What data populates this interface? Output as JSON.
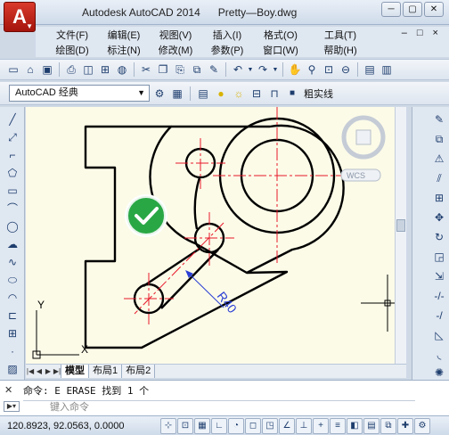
{
  "app": {
    "product": "Autodesk AutoCAD 2014",
    "filename": "Pretty—Boy.dwg",
    "logo_letter": "A"
  },
  "window_controls": {
    "minimize": "─",
    "restore": "▢",
    "close": "✕"
  },
  "menu": {
    "row1": [
      "文件(F)",
      "编辑(E)",
      "视图(V)",
      "插入(I)",
      "格式(O)",
      "工具(T)"
    ],
    "row2": [
      "绘图(D)",
      "标注(N)",
      "修改(M)",
      "参数(P)",
      "窗口(W)",
      "帮助(H)"
    ],
    "doc_controls": "– □ ×"
  },
  "workspace": {
    "current": "AutoCAD 经典",
    "layer": "粗实线"
  },
  "viewcube": {
    "label": "WCS"
  },
  "layout_tabs": [
    "模型",
    "布局1",
    "布局2"
  ],
  "dimension": {
    "text": "R40"
  },
  "ucs": {
    "x": "X",
    "y": "Y"
  },
  "command": {
    "history": "命令: E ERASE 找到 1 个",
    "placeholder": "键入命令"
  },
  "status": {
    "coordinates": "120.8923, 92.0563, 0.0000"
  },
  "colors": {
    "canvas": "#fcfbe8",
    "centerline": "#e8182a",
    "dimension": "#2a3fd4",
    "geometry": "#000000",
    "check": "#29a745"
  }
}
